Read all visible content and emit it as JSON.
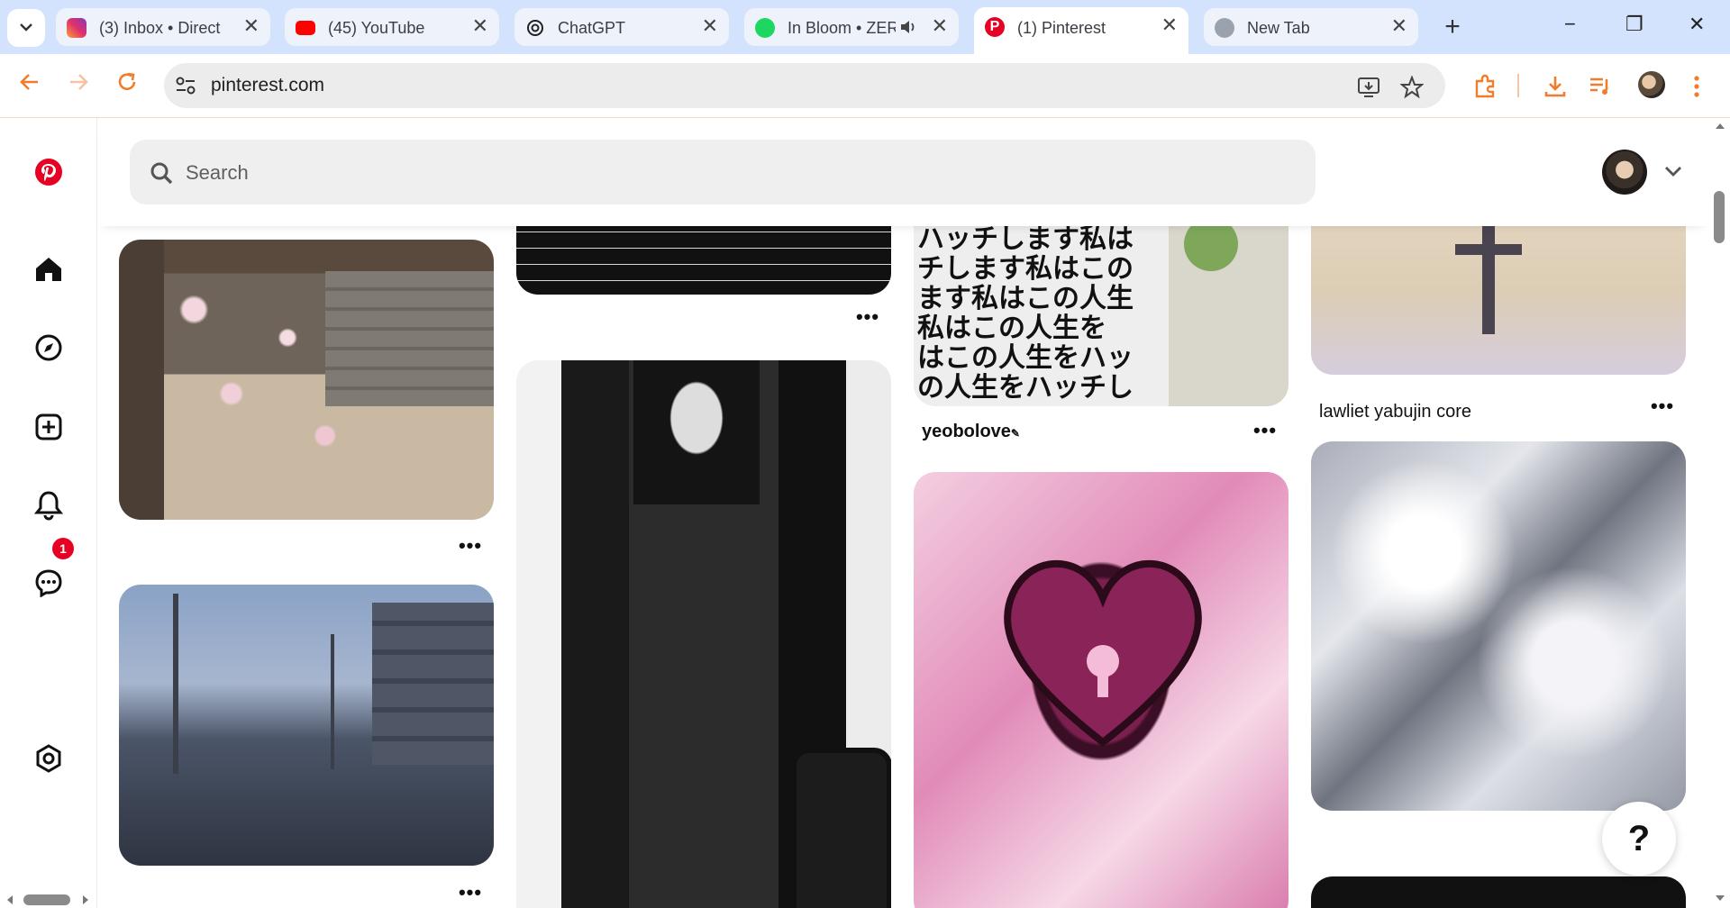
{
  "browser": {
    "tabs": [
      {
        "title": "(3) Inbox • Direct",
        "favicon": "instagram-icon",
        "active": false
      },
      {
        "title": "(45) YouTube",
        "favicon": "youtube-icon",
        "active": false
      },
      {
        "title": "ChatGPT",
        "favicon": "chatgpt-icon",
        "active": false
      },
      {
        "title": "In Bloom • ZEROBASEONE",
        "favicon": "spotify-icon",
        "active": false,
        "audio": true
      },
      {
        "title": "(1) Pinterest",
        "favicon": "pinterest-icon",
        "active": true
      },
      {
        "title": "New Tab",
        "favicon": "globe-icon",
        "active": false
      }
    ],
    "new_tab_label": "+",
    "minimize": "−",
    "maximize": "❐",
    "close": "✕",
    "address": "pinterest.com"
  },
  "colors": {
    "pinterest_red": "#e60023",
    "tab_strip": "#d3e3fd",
    "accent_orange": "#f07c2c"
  },
  "sidebar": {
    "items": [
      "pinterest-logo-icon",
      "home-icon",
      "explore-icon",
      "create-icon",
      "notifications-icon",
      "messages-icon",
      "settings-icon"
    ],
    "notification_count": "1"
  },
  "header": {
    "search_placeholder": "Search"
  },
  "feed": {
    "pins": [
      {
        "column": 1,
        "title": ""
      },
      {
        "column": 1,
        "title": ""
      },
      {
        "column": 2,
        "title": ""
      },
      {
        "column": 2,
        "title": ""
      },
      {
        "column": 3,
        "title": "yeobolove",
        "title_suffix": "✎"
      },
      {
        "column": 3,
        "title": ""
      },
      {
        "column": 4,
        "title": "lawliet yabujin core"
      },
      {
        "column": 4,
        "title": ""
      }
    ],
    "more_label": "•••",
    "jp_text": "ハッチします私は\nチします私はこの\nます私はこの人生\n私はこの人生を\nはこの人生をハッ\nの人生をハッチし"
  },
  "help_label": "?"
}
